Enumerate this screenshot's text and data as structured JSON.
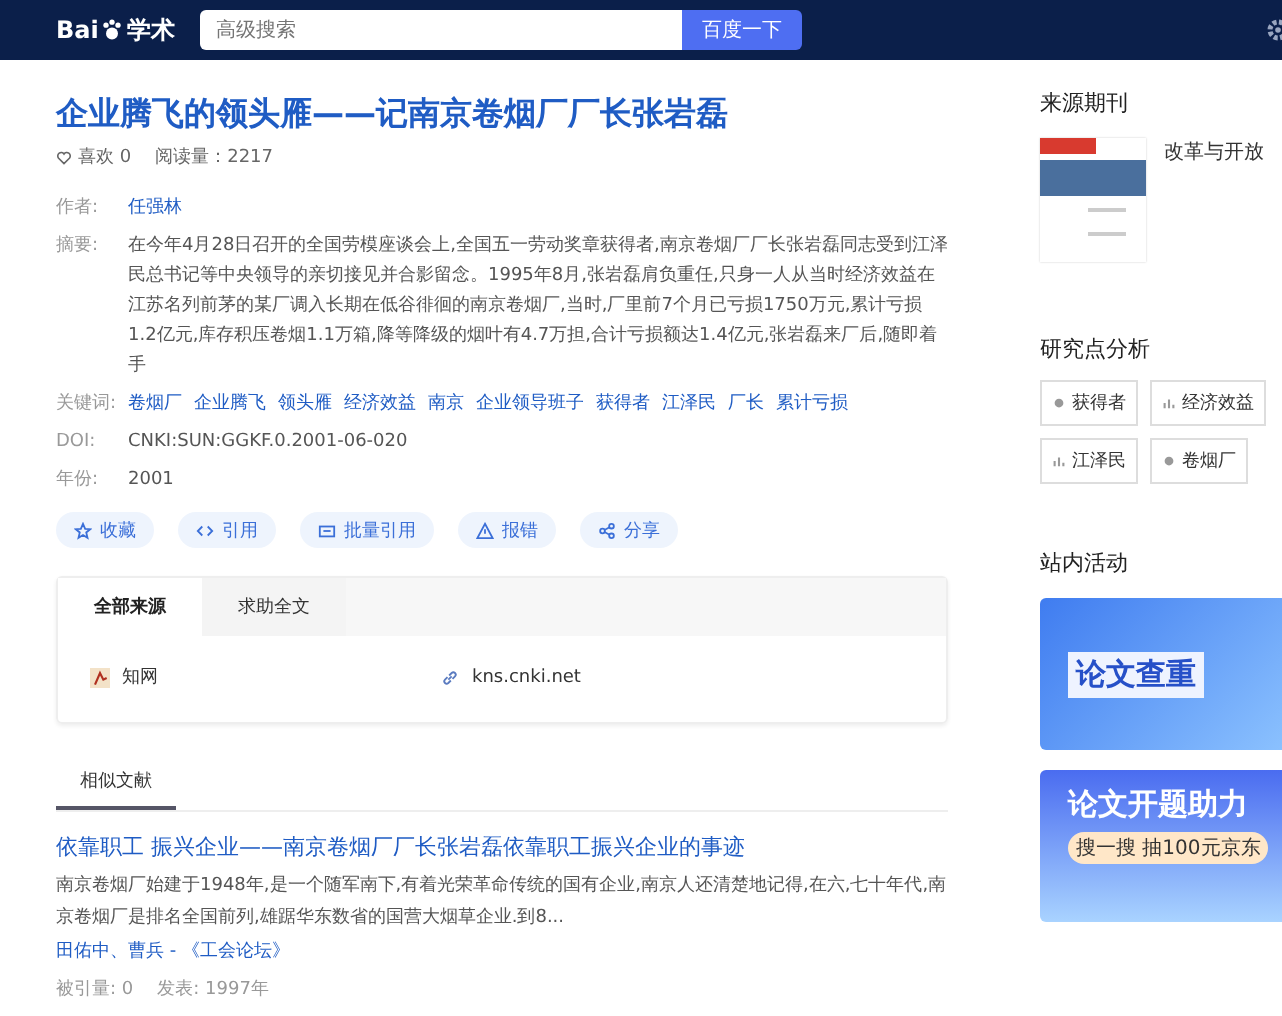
{
  "header": {
    "logo_text": "Bai",
    "logo_suffix": "学术",
    "search": {
      "placeholder": "高级搜索"
    },
    "search_button": "百度一下"
  },
  "article": {
    "title": "企业腾飞的领头雁——记南京卷烟厂厂长张岩磊",
    "likes": "喜欢 0",
    "reads": "阅读量：2217",
    "fields": [
      {
        "kind": "links",
        "label": "作者:",
        "values": [
          "任强林"
        ]
      },
      {
        "kind": "text",
        "label": "摘要:",
        "value": "在今年4月28日召开的全国劳模座谈会上,全国五一劳动奖章获得者,南京卷烟厂厂长张岩磊同志受到江泽民总书记等中央领导的亲切接见并合影留念。1995年8月,张岩磊肩负重任,只身一人从当时经济效益在江苏名列前茅的某厂调入长期在低谷徘徊的南京卷烟厂,当时,厂里前7个月已亏损1750万元,累计亏损1.2亿元,库存积压卷烟1.1万箱,降等降级的烟叶有4.7万担,合计亏损额达1.4亿元,张岩磊来厂后,随即着手"
      },
      {
        "kind": "links",
        "label": "关键词:",
        "values": [
          "卷烟厂",
          "企业腾飞",
          "领头雁",
          "经济效益",
          "南京",
          "企业领导班子",
          "获得者",
          "江泽民",
          "厂长",
          "累计亏损"
        ]
      },
      {
        "kind": "text",
        "label": "DOI:",
        "value": "CNKI:SUN:GGKF.0.2001-06-020"
      },
      {
        "kind": "text",
        "label": "年份:",
        "value": "2001"
      }
    ],
    "actions": [
      {
        "kind": "star",
        "label": "收藏"
      },
      {
        "kind": "code",
        "label": "引用"
      },
      {
        "kind": "batch",
        "label": "批量引用"
      },
      {
        "kind": "warn",
        "label": "报错"
      },
      {
        "kind": "share",
        "label": "分享"
      }
    ]
  },
  "sources": {
    "tabs": [
      {
        "label": "全部来源",
        "selected": true
      },
      {
        "label": "求助全文",
        "selected": false
      }
    ],
    "name": "知网",
    "url": "kns.cnki.net"
  },
  "similar": {
    "tab": "相似文献",
    "items": [
      {
        "title": "依靠职工 振兴企业——南京卷烟厂厂长张岩磊依靠职工振兴企业的事迹",
        "snippet": "南京卷烟厂始建于1948年,是一个随军南下,有着光荣革命传统的国有企业,南京人还清楚地记得,在六,七十年代,南京卷烟厂是排名全国前列,雄踞华东数省的国营大烟草企业.到8...",
        "authors": "田佑中、曹兵 - 《工会论坛》",
        "cited": "被引量: 0",
        "published": "发表: 1997年"
      }
    ]
  },
  "sidebar": {
    "journal_heading": "来源期刊",
    "journal_name": "改革与开放",
    "analysis_heading": "研究点分析",
    "points": [
      {
        "kind": "dot",
        "label": "获得者"
      },
      {
        "kind": "bars",
        "label": "经济效益"
      },
      {
        "kind": "bars",
        "label": "江泽民"
      },
      {
        "kind": "dot",
        "label": "卷烟厂"
      }
    ],
    "activity_heading": "站内活动",
    "banners": [
      {
        "title": "论文查重"
      },
      {
        "title": "论文开题助力",
        "subtitle": "搜一搜 抽100元京东"
      }
    ]
  }
}
